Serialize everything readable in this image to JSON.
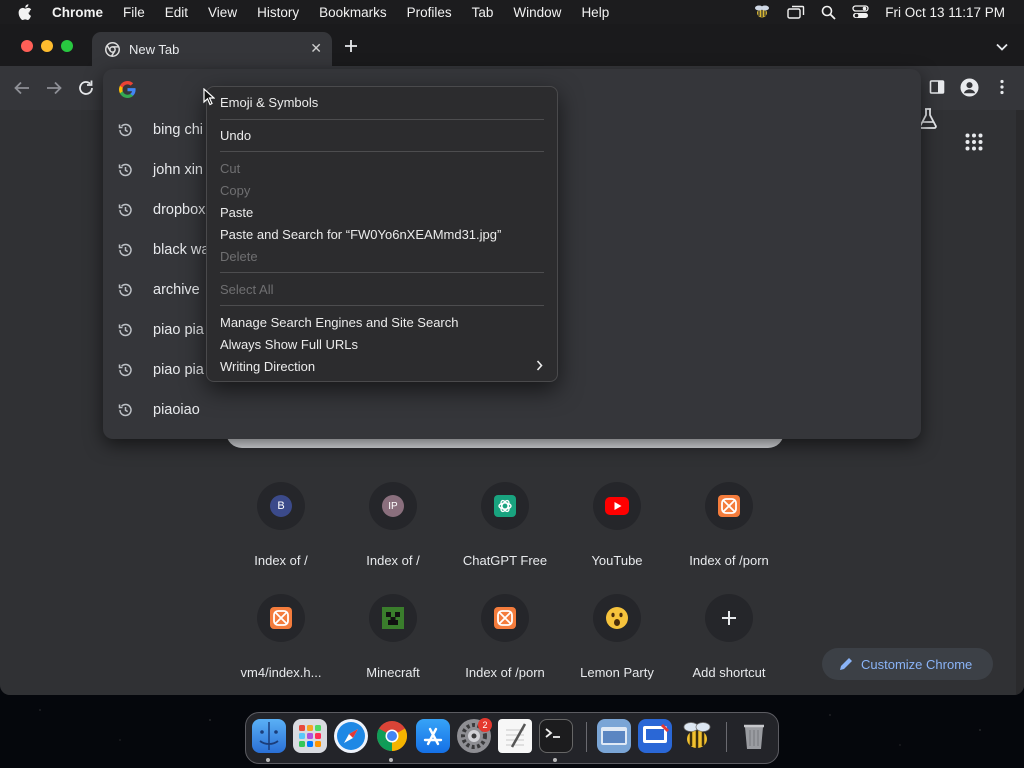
{
  "menubar": {
    "app": "Chrome",
    "items": [
      "File",
      "Edit",
      "View",
      "History",
      "Bookmarks",
      "Profiles",
      "Tab",
      "Window",
      "Help"
    ],
    "clock": "Fri Oct 13  11:17 PM"
  },
  "tab": {
    "title": "New Tab"
  },
  "omnibox": {
    "suggestions": [
      "bing chi",
      "john xin",
      "dropbox",
      "black wa",
      "archive",
      "piao pia",
      "piao pia",
      "piaoiao"
    ]
  },
  "context_menu": {
    "emoji": "Emoji & Symbols",
    "undo": "Undo",
    "cut": "Cut",
    "copy": "Copy",
    "paste": "Paste",
    "paste_search": "Paste and Search for “FW0Yo6nXEAMmd31.jpg”",
    "delete": "Delete",
    "select_all": "Select All",
    "manage": "Manage Search Engines and Site Search",
    "always_full": "Always Show Full URLs",
    "writing": "Writing Direction"
  },
  "shortcuts": [
    {
      "label": "Index of /",
      "letter": "B",
      "color": "#3b4a8a"
    },
    {
      "label": "Index of /",
      "letter": "IP",
      "color": "#8a6f7d"
    },
    {
      "label": "ChatGPT Free",
      "letter": "",
      "color": "#19a37f"
    },
    {
      "label": "YouTube",
      "letter": "",
      "color": "#ff0000"
    },
    {
      "label": "Index of /porn",
      "letter": "",
      "color": "#f47c3c"
    },
    {
      "label": "vm4/index.h...",
      "letter": "",
      "color": "#f47c3c"
    },
    {
      "label": "Minecraft",
      "letter": "",
      "color": "#3a7d2c"
    },
    {
      "label": "Index of /porn",
      "letter": "",
      "color": "#f47c3c"
    },
    {
      "label": "Lemon Party",
      "letter": "",
      "color": "#f6c33c"
    },
    {
      "label": "Add shortcut",
      "letter": "+",
      "color": "#e8eaed"
    }
  ],
  "customize": "Customize Chrome",
  "dock": {
    "badge": "2"
  }
}
